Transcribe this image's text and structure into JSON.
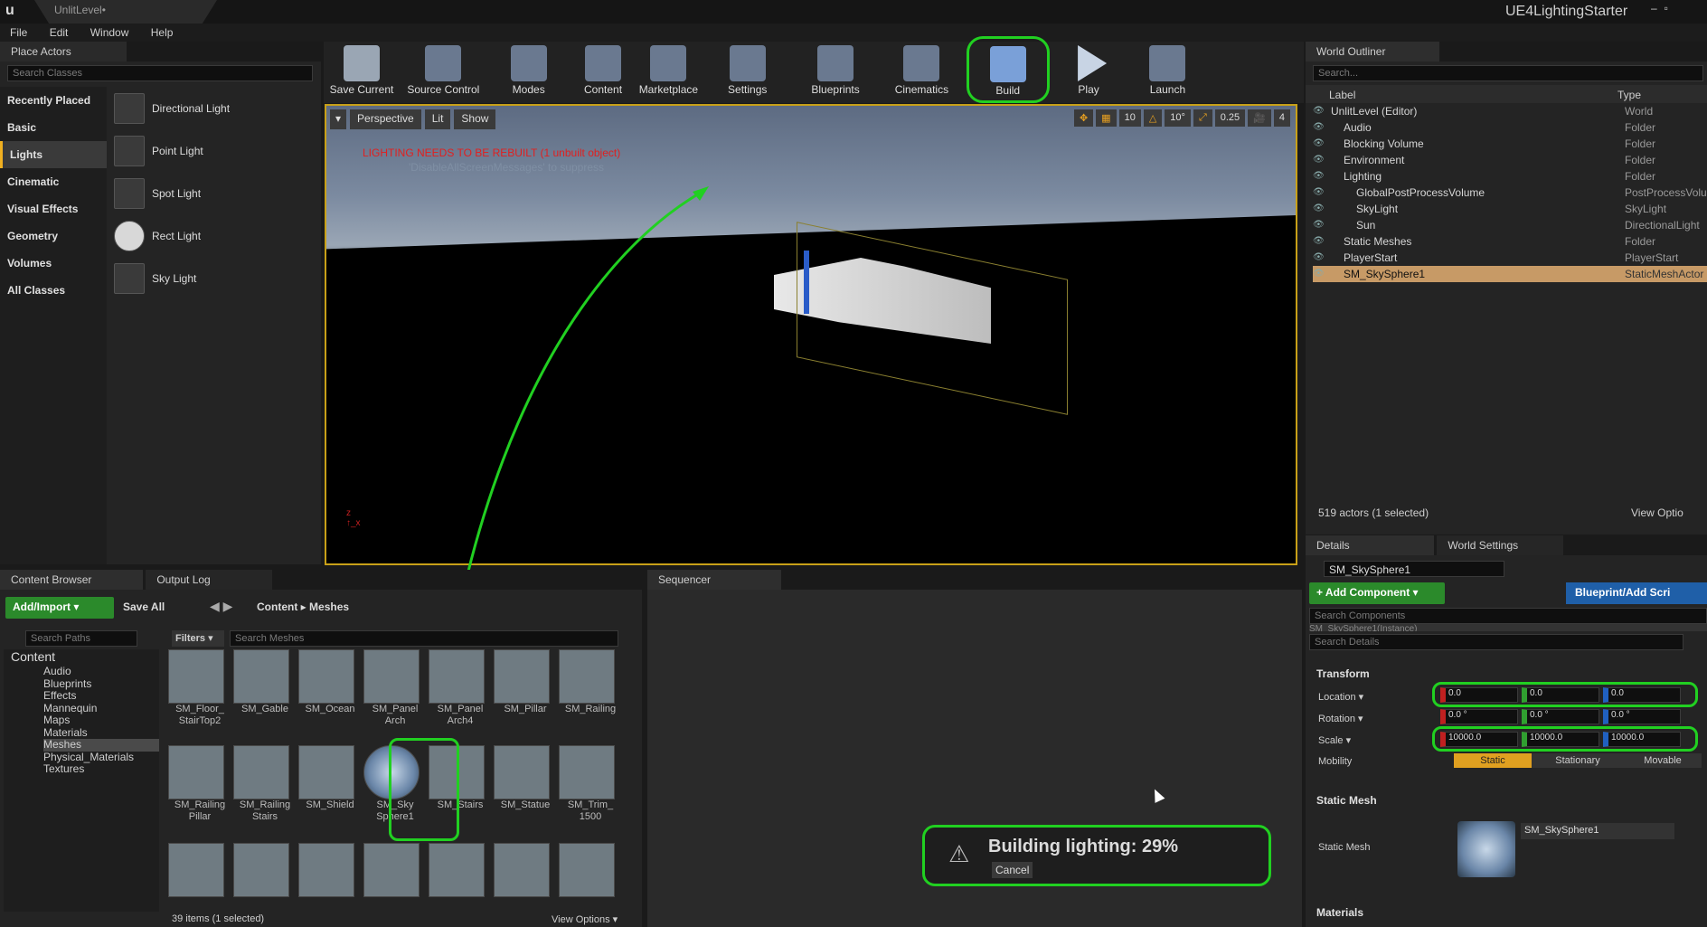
{
  "window": {
    "level_tab": "UnlitLevel•",
    "project_name": "UE4LightingStarter"
  },
  "menu": [
    "File",
    "Edit",
    "Window",
    "Help"
  ],
  "place_actors": {
    "tab": "Place Actors",
    "search_placeholder": "Search Classes",
    "categories": [
      "Recently Placed",
      "Basic",
      "Lights",
      "Cinematic",
      "Visual Effects",
      "Geometry",
      "Volumes",
      "All Classes"
    ],
    "selected_category": "Lights",
    "items": [
      "Directional Light",
      "Point Light",
      "Spot Light",
      "Rect Light",
      "Sky Light"
    ]
  },
  "toolbar": {
    "buttons": [
      "Save Current",
      "Source Control",
      "Modes",
      "Content",
      "Marketplace",
      "Settings",
      "Blueprints",
      "Cinematics",
      "Build",
      "Play",
      "Launch"
    ]
  },
  "viewport": {
    "perspective": "Perspective",
    "lit": "Lit",
    "show": "Show",
    "warning": "LIGHTING NEEDS TO BE REBUILT (1 unbuilt object)",
    "suppress": "'DisableAllScreenMessages' to suppress",
    "grid_snap": "10",
    "rot_snap": "10°",
    "scale_snap": "0.25",
    "cam_speed": "4"
  },
  "outliner": {
    "tab": "World Outliner",
    "search_placeholder": "Search...",
    "col_label": "Label",
    "col_type": "Type",
    "rows": [
      {
        "label": "UnlitLevel (Editor)",
        "type": "World"
      },
      {
        "label": "Audio",
        "type": "Folder"
      },
      {
        "label": "Blocking Volume",
        "type": "Folder"
      },
      {
        "label": "Environment",
        "type": "Folder"
      },
      {
        "label": "Lighting",
        "type": "Folder"
      },
      {
        "label": "GlobalPostProcessVolume",
        "type": "PostProcessVolum"
      },
      {
        "label": "SkyLight",
        "type": "SkyLight"
      },
      {
        "label": "Sun",
        "type": "DirectionalLight"
      },
      {
        "label": "Static Meshes",
        "type": "Folder"
      },
      {
        "label": "PlayerStart",
        "type": "PlayerStart"
      },
      {
        "label": "SM_SkySphere1",
        "type": "StaticMeshActor"
      }
    ],
    "status": "519 actors (1 selected)",
    "view_options": "View Optio"
  },
  "details": {
    "tab_details": "Details",
    "tab_world": "World Settings",
    "object_name": "SM_SkySphere1",
    "add_component": "+ Add Component ▾",
    "blueprint_btn": "Blueprint/Add Scri",
    "search_components": "Search Components",
    "instance": "SM_SkySphere1(Instance)",
    "search_details": "Search Details",
    "transform": "Transform",
    "location_label": "Location ▾",
    "rotation_label": "Rotation ▾",
    "scale_label": "Scale ▾",
    "mobility_label": "Mobility",
    "location": [
      "0.0",
      "0.0",
      "0.0"
    ],
    "rotation": [
      "0.0 °",
      "0.0 °",
      "0.0 °"
    ],
    "scale": [
      "10000.0",
      "10000.0",
      "10000.0"
    ],
    "mobility": [
      "Static",
      "Stationary",
      "Movable"
    ],
    "static_mesh_section": "Static Mesh",
    "static_mesh_label": "Static Mesh",
    "static_mesh_value": "SM_SkySphere1",
    "materials_section": "Materials"
  },
  "content_browser": {
    "tab": "Content Browser",
    "tab_output": "Output Log",
    "add_import": "Add/Import ▾",
    "save_all": "Save All",
    "path": [
      "Content",
      "Meshes"
    ],
    "search_paths": "Search Paths",
    "filters": "Filters ▾",
    "search_meshes": "Search Meshes",
    "tree_root": "Content",
    "folders": [
      "Audio",
      "Blueprints",
      "Effects",
      "Mannequin",
      "Maps",
      "Materials",
      "Meshes",
      "Physical_Materials",
      "Textures"
    ],
    "assets_row1": [
      "SM_Floor_ StairTop2",
      "SM_Gable",
      "SM_Ocean",
      "SM_Panel Arch",
      "SM_Panel Arch4",
      "SM_Pillar",
      "SM_Railing"
    ],
    "assets_row2": [
      "SM_Railing Pillar",
      "SM_Railing Stairs",
      "SM_Shield",
      "SM_Sky Sphere1",
      "SM_Stairs",
      "SM_Statue",
      "SM_Trim_ 1500"
    ],
    "status": "39 items (1 selected)",
    "view_options": "View Options ▾"
  },
  "sequencer": {
    "tab": "Sequencer"
  },
  "build_popup": {
    "text": "Building lighting:  29%",
    "cancel": "Cancel"
  }
}
